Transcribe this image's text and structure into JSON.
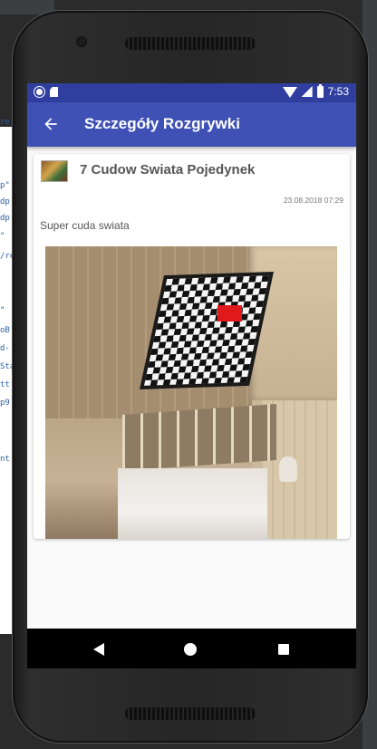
{
  "status_bar": {
    "time": "7:53",
    "icons": [
      "notification-dot-icon",
      "sim-card-icon",
      "wifi-icon",
      "signal-icon",
      "battery-icon"
    ]
  },
  "app_bar": {
    "title": "Szczegóły Rozgrywki",
    "back_icon": "arrow-back-icon",
    "color": "#3f51b5",
    "status_color": "#303f9f"
  },
  "card": {
    "title": "7 Cudow Swiata Pojedynek",
    "date": "23.08.2018 07:29",
    "description": "Super cuda swiata",
    "thumbnail": "game-box-thumbnail"
  },
  "nav_bar": {
    "icons": [
      "nav-back-icon",
      "nav-home-icon",
      "nav-recents-icon"
    ]
  },
  "ide_code": {
    "lines": [
      "re",
      "p\"",
      "dp'",
      "dp'",
      "\"",
      "/re",
      "\"",
      "oB",
      "d-",
      "Sta",
      "tt",
      "p9",
      "nt"
    ]
  }
}
